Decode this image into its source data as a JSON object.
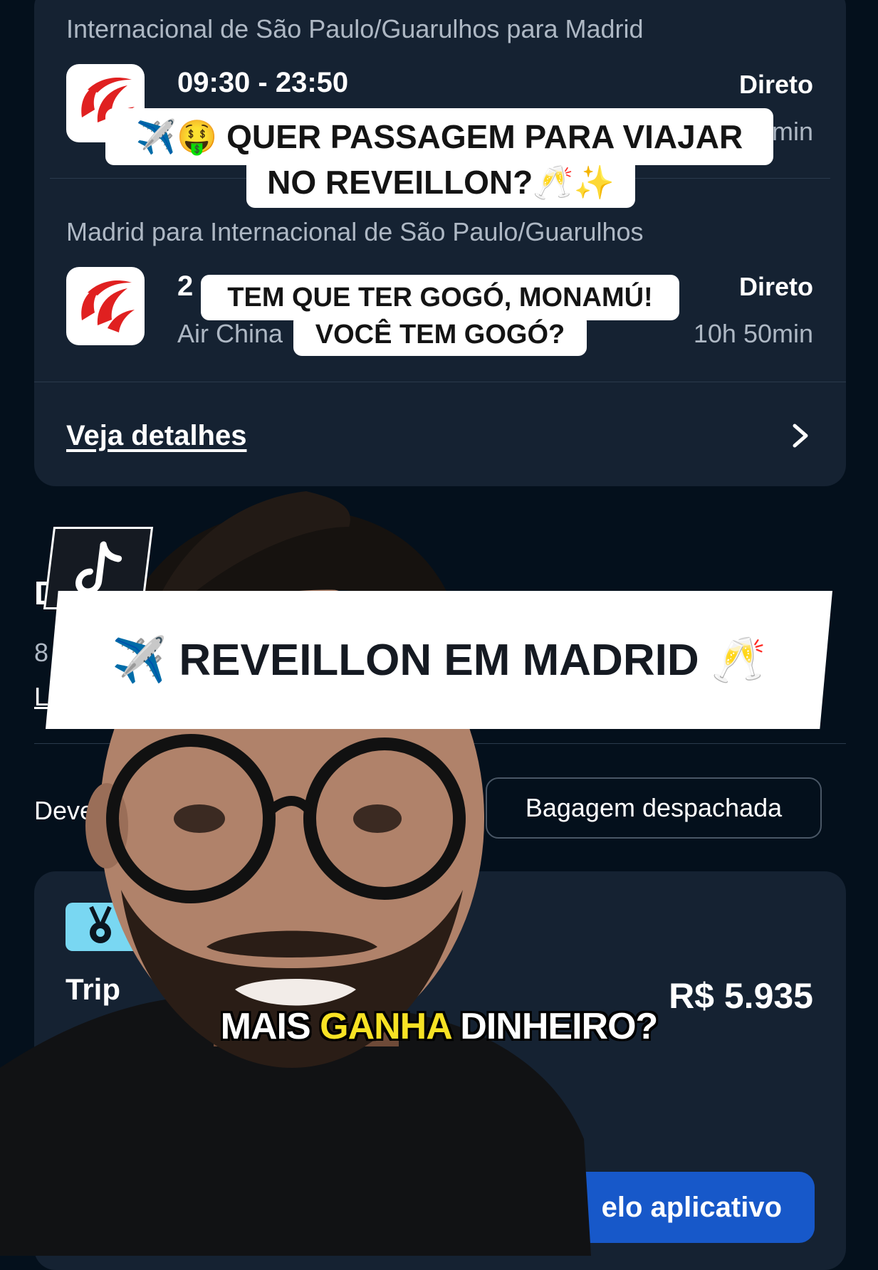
{
  "flights": {
    "outbound": {
      "route": "Internacional de São Paulo/Guarulhos para Madrid",
      "time": "09:30 - 23:50",
      "stops": "Direto",
      "duration_fragment": "min"
    },
    "return": {
      "route": "Madrid para Internacional de São Paulo/Guarulhos",
      "time_fragment": "2",
      "airline": "Air China",
      "stops": "Direto",
      "duration": "10h 50min"
    },
    "details_link": "Veja detalhes"
  },
  "partial": {
    "section_heading_fragment": "D",
    "line_fragment_1": "8",
    "line_fragment_2": "L",
    "filter_fragment": "Deve"
  },
  "filters": {
    "checked_bag": "Bagagem despachada"
  },
  "offer": {
    "provider_fragment": "Trip",
    "price": "R$ 5.935",
    "cta_fragment": "elo aplicativo"
  },
  "captions": {
    "top_line_1": "✈️🤑 QUER PASSAGEM PARA VIAJAR",
    "top_line_2": "NO REVEILLON?🥂✨",
    "mid_line_1": "TEM QUE TER GOGÓ, MONAMÚ!",
    "mid_line_2": "VOCÊ TEM GOGÓ?",
    "banner": "✈️ REVEILLON EM MADRID 🥂",
    "subtitle_before": "MAIS ",
    "subtitle_highlight": "GANHA",
    "subtitle_after": " DINHEIRO?"
  },
  "colors": {
    "background": "#04101c",
    "card": "#152232",
    "cta": "#1758c9",
    "airline_red": "#e02020",
    "highlight_yellow": "#f7e224"
  }
}
